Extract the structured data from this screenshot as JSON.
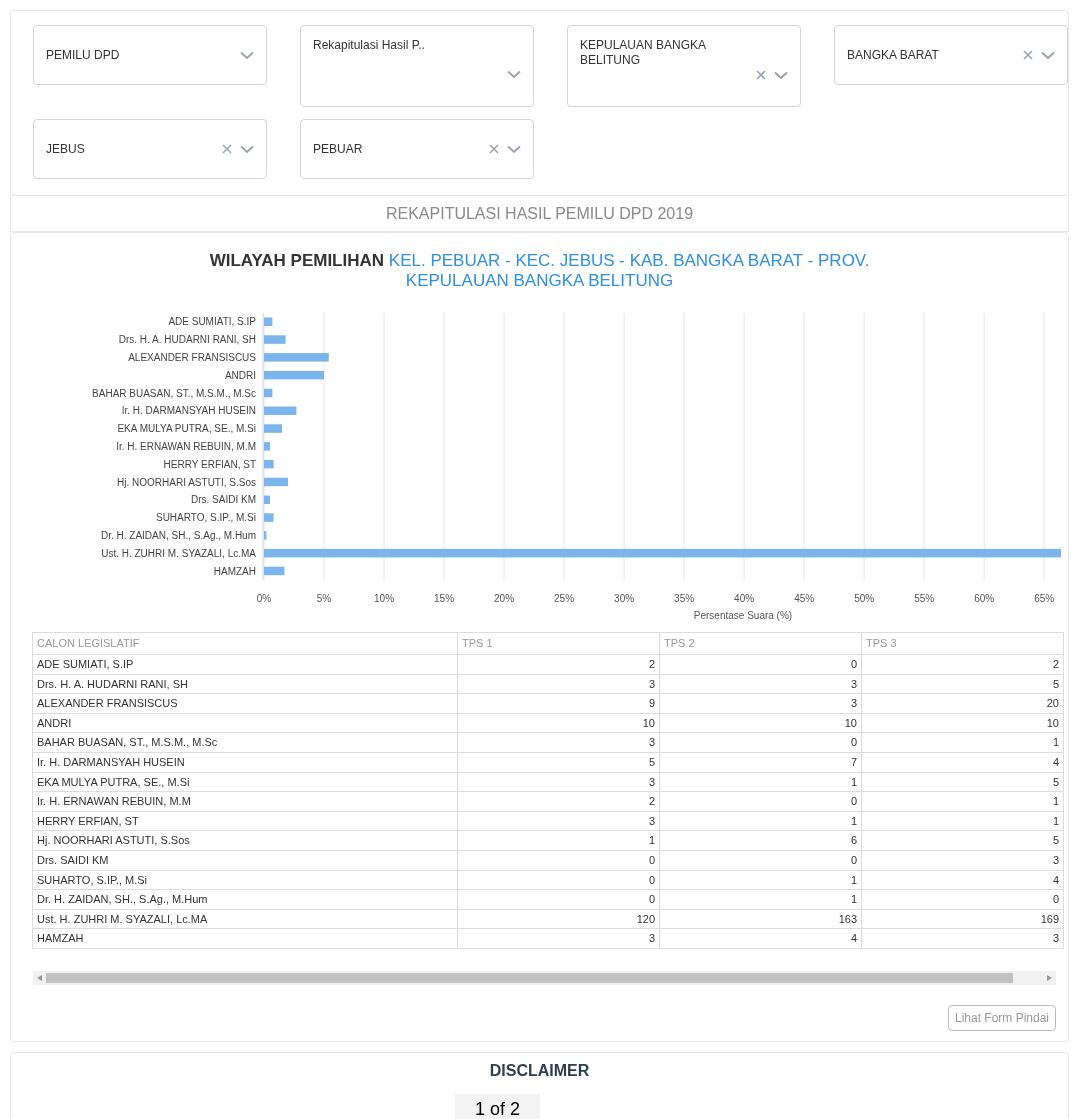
{
  "filters": [
    {
      "value": "PEMILU DPD",
      "clearable": false,
      "tall": false
    },
    {
      "value": "Rekapitulasi Hasil P..",
      "clearable": false,
      "tall": true
    },
    {
      "value": "KEPULAUAN BANGKA BELITUNG",
      "clearable": true,
      "tall": true
    },
    {
      "value": "BANGKA BARAT",
      "clearable": true,
      "tall": false
    },
    {
      "value": "JEBUS",
      "clearable": true,
      "tall": false
    },
    {
      "value": "PEBUAR",
      "clearable": true,
      "tall": false
    }
  ],
  "section_title": "REKAPITULASI HASIL PEMILU DPD 2019",
  "chart_title": {
    "prefix": "WILAYAH PEMILIHAN",
    "region": "KEL. PEBUAR - KEC. JEBUS - KAB. BANGKA BARAT - PROV. KEPULAUAN BANGKA BELITUNG"
  },
  "chart_data": {
    "type": "bar",
    "orientation": "horizontal",
    "xlabel": "Persentase Suara (%)",
    "categories": [
      "ADE SUMIATI, S.IP",
      "Drs. H. A. HUDARNI RANI, SH",
      "ALEXANDER FRANSISCUS",
      "ANDRI",
      "BAHAR BUASAN, ST., M.S.M., M.Sc",
      "Ir. H. DARMANSYAH HUSEIN",
      "EKA MULYA PUTRA, SE., M.Si",
      "Ir. H. ERNAWAN REBUIN, M.M",
      "HERRY ERFIAN, ST",
      "Hj. NOORHARI ASTUTI, S.Sos",
      "Drs. SAIDI KM",
      "SUHARTO, S.IP., M.Si",
      "Dr. H. ZAIDAN, SH., S.Ag., M.Hum",
      "Ust. H. ZUHRI M. SYAZALI, Lc.MA",
      "HAMZAH"
    ],
    "series": [
      {
        "color": "#7cb5ec",
        "values": [
          0.7,
          1.8,
          5.4,
          5.0,
          0.7,
          2.7,
          1.5,
          0.5,
          0.8,
          2.0,
          0.5,
          0.8,
          0.2,
          66.4,
          1.7
        ]
      }
    ],
    "grid": true,
    "xlim": [
      0,
      66.4
    ],
    "xticks": [
      {
        "value": 0,
        "label": "0%"
      },
      {
        "value": 5,
        "label": "5%"
      },
      {
        "value": 10,
        "label": "10%"
      },
      {
        "value": 15,
        "label": "15%"
      },
      {
        "value": 20,
        "label": "20%"
      },
      {
        "value": 25,
        "label": "25%"
      },
      {
        "value": 30,
        "label": "30%"
      },
      {
        "value": 35,
        "label": "35%"
      },
      {
        "value": 40,
        "label": "40%"
      },
      {
        "value": 45,
        "label": "45%"
      },
      {
        "value": 50,
        "label": "50%"
      },
      {
        "value": 55,
        "label": "55%"
      },
      {
        "value": 60,
        "label": "60%"
      },
      {
        "value": 65,
        "label": "65%"
      }
    ]
  },
  "table": {
    "columns": [
      "CALON LEGISLATIF",
      "TPS 1",
      "TPS 2",
      "TPS 3"
    ],
    "rows": [
      [
        "ADE SUMIATI, S.IP",
        "2",
        "0",
        "2"
      ],
      [
        "Drs. H. A. HUDARNI RANI, SH",
        "3",
        "3",
        "5"
      ],
      [
        "ALEXANDER FRANSISCUS",
        "9",
        "3",
        "20"
      ],
      [
        "ANDRI",
        "10",
        "10",
        "10"
      ],
      [
        "BAHAR BUASAN, ST., M.S.M., M.Sc",
        "3",
        "0",
        "1"
      ],
      [
        "Ir. H. DARMANSYAH HUSEIN",
        "5",
        "7",
        "4"
      ],
      [
        "EKA MULYA PUTRA, SE., M.Si",
        "3",
        "1",
        "5"
      ],
      [
        "Ir. H. ERNAWAN REBUIN, M.M",
        "2",
        "0",
        "1"
      ],
      [
        "HERRY ERFIAN, ST",
        "3",
        "1",
        "1"
      ],
      [
        "Hj. NOORHARI ASTUTI, S.Sos",
        "1",
        "6",
        "5"
      ],
      [
        "Drs. SAIDI KM",
        "0",
        "0",
        "3"
      ],
      [
        "SUHARTO, S.IP., M.Si",
        "0",
        "1",
        "4"
      ],
      [
        "Dr. H. ZAIDAN, SH., S.Ag., M.Hum",
        "0",
        "1",
        "0"
      ],
      [
        "Ust. H. ZUHRI M. SYAZALI, Lc.MA",
        "120",
        "163",
        "169"
      ],
      [
        "HAMZAH",
        "3",
        "4",
        "3"
      ]
    ]
  },
  "scan_button": "Lihat Form Pindai",
  "disclaimer_title": "DISCLAIMER",
  "page_indicator": "1 of 2"
}
